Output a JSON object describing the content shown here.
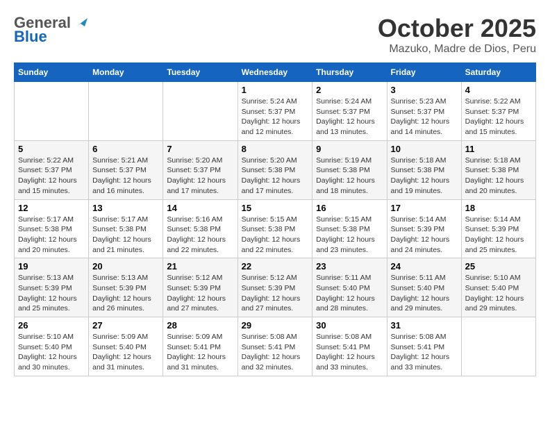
{
  "header": {
    "logo_general": "General",
    "logo_blue": "Blue",
    "month": "October 2025",
    "subtitle": "Mazuko, Madre de Dios, Peru"
  },
  "weekdays": [
    "Sunday",
    "Monday",
    "Tuesday",
    "Wednesday",
    "Thursday",
    "Friday",
    "Saturday"
  ],
  "weeks": [
    [
      null,
      null,
      null,
      {
        "day": 1,
        "sunrise": "5:24 AM",
        "sunset": "5:37 PM",
        "daylight": "12 hours and 12 minutes."
      },
      {
        "day": 2,
        "sunrise": "5:24 AM",
        "sunset": "5:37 PM",
        "daylight": "12 hours and 13 minutes."
      },
      {
        "day": 3,
        "sunrise": "5:23 AM",
        "sunset": "5:37 PM",
        "daylight": "12 hours and 14 minutes."
      },
      {
        "day": 4,
        "sunrise": "5:22 AM",
        "sunset": "5:37 PM",
        "daylight": "12 hours and 15 minutes."
      }
    ],
    [
      {
        "day": 5,
        "sunrise": "5:22 AM",
        "sunset": "5:37 PM",
        "daylight": "12 hours and 15 minutes."
      },
      {
        "day": 6,
        "sunrise": "5:21 AM",
        "sunset": "5:37 PM",
        "daylight": "12 hours and 16 minutes."
      },
      {
        "day": 7,
        "sunrise": "5:20 AM",
        "sunset": "5:37 PM",
        "daylight": "12 hours and 17 minutes."
      },
      {
        "day": 8,
        "sunrise": "5:20 AM",
        "sunset": "5:38 PM",
        "daylight": "12 hours and 17 minutes."
      },
      {
        "day": 9,
        "sunrise": "5:19 AM",
        "sunset": "5:38 PM",
        "daylight": "12 hours and 18 minutes."
      },
      {
        "day": 10,
        "sunrise": "5:18 AM",
        "sunset": "5:38 PM",
        "daylight": "12 hours and 19 minutes."
      },
      {
        "day": 11,
        "sunrise": "5:18 AM",
        "sunset": "5:38 PM",
        "daylight": "12 hours and 20 minutes."
      }
    ],
    [
      {
        "day": 12,
        "sunrise": "5:17 AM",
        "sunset": "5:38 PM",
        "daylight": "12 hours and 20 minutes."
      },
      {
        "day": 13,
        "sunrise": "5:17 AM",
        "sunset": "5:38 PM",
        "daylight": "12 hours and 21 minutes."
      },
      {
        "day": 14,
        "sunrise": "5:16 AM",
        "sunset": "5:38 PM",
        "daylight": "12 hours and 22 minutes."
      },
      {
        "day": 15,
        "sunrise": "5:15 AM",
        "sunset": "5:38 PM",
        "daylight": "12 hours and 22 minutes."
      },
      {
        "day": 16,
        "sunrise": "5:15 AM",
        "sunset": "5:38 PM",
        "daylight": "12 hours and 23 minutes."
      },
      {
        "day": 17,
        "sunrise": "5:14 AM",
        "sunset": "5:39 PM",
        "daylight": "12 hours and 24 minutes."
      },
      {
        "day": 18,
        "sunrise": "5:14 AM",
        "sunset": "5:39 PM",
        "daylight": "12 hours and 25 minutes."
      }
    ],
    [
      {
        "day": 19,
        "sunrise": "5:13 AM",
        "sunset": "5:39 PM",
        "daylight": "12 hours and 25 minutes."
      },
      {
        "day": 20,
        "sunrise": "5:13 AM",
        "sunset": "5:39 PM",
        "daylight": "12 hours and 26 minutes."
      },
      {
        "day": 21,
        "sunrise": "5:12 AM",
        "sunset": "5:39 PM",
        "daylight": "12 hours and 27 minutes."
      },
      {
        "day": 22,
        "sunrise": "5:12 AM",
        "sunset": "5:39 PM",
        "daylight": "12 hours and 27 minutes."
      },
      {
        "day": 23,
        "sunrise": "5:11 AM",
        "sunset": "5:40 PM",
        "daylight": "12 hours and 28 minutes."
      },
      {
        "day": 24,
        "sunrise": "5:11 AM",
        "sunset": "5:40 PM",
        "daylight": "12 hours and 29 minutes."
      },
      {
        "day": 25,
        "sunrise": "5:10 AM",
        "sunset": "5:40 PM",
        "daylight": "12 hours and 29 minutes."
      }
    ],
    [
      {
        "day": 26,
        "sunrise": "5:10 AM",
        "sunset": "5:40 PM",
        "daylight": "12 hours and 30 minutes."
      },
      {
        "day": 27,
        "sunrise": "5:09 AM",
        "sunset": "5:40 PM",
        "daylight": "12 hours and 31 minutes."
      },
      {
        "day": 28,
        "sunrise": "5:09 AM",
        "sunset": "5:41 PM",
        "daylight": "12 hours and 31 minutes."
      },
      {
        "day": 29,
        "sunrise": "5:08 AM",
        "sunset": "5:41 PM",
        "daylight": "12 hours and 32 minutes."
      },
      {
        "day": 30,
        "sunrise": "5:08 AM",
        "sunset": "5:41 PM",
        "daylight": "12 hours and 33 minutes."
      },
      {
        "day": 31,
        "sunrise": "5:08 AM",
        "sunset": "5:41 PM",
        "daylight": "12 hours and 33 minutes."
      },
      null
    ]
  ]
}
